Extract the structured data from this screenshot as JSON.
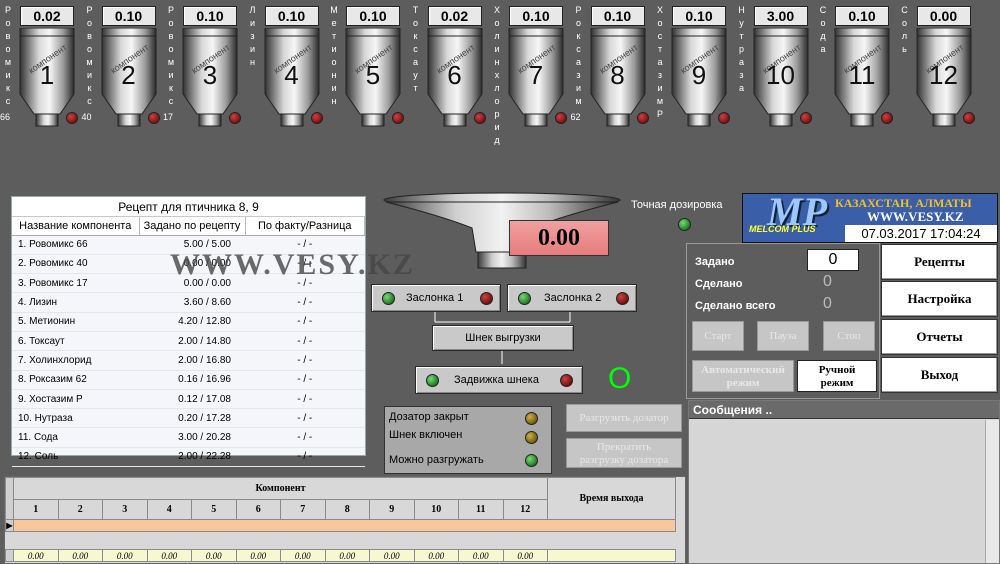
{
  "hoppers": [
    {
      "num": "1",
      "value": "0.02",
      "vname": "Ровомикс",
      "extra": "66"
    },
    {
      "num": "2",
      "value": "0.10",
      "vname": "Ровомикс",
      "extra": "40"
    },
    {
      "num": "3",
      "value": "0.10",
      "vname": "Ровомикс",
      "extra": "17"
    },
    {
      "num": "4",
      "value": "0.10",
      "vname": "Лизин",
      "extra": ""
    },
    {
      "num": "5",
      "value": "0.10",
      "vname": "Метионин",
      "extra": ""
    },
    {
      "num": "6",
      "value": "0.02",
      "vname": "Токсаут",
      "extra": ""
    },
    {
      "num": "7",
      "value": "0.10",
      "vname": "Холинхлорид",
      "extra": ""
    },
    {
      "num": "8",
      "value": "0.10",
      "vname": "Роксазим",
      "extra": "62"
    },
    {
      "num": "9",
      "value": "0.10",
      "vname": "ХостазимР",
      "extra": ""
    },
    {
      "num": "10",
      "value": "3.00",
      "vname": "Нутраза",
      "extra": ""
    },
    {
      "num": "11",
      "value": "0.10",
      "vname": "Сода",
      "extra": ""
    },
    {
      "num": "12",
      "value": "0.00",
      "vname": "Соль",
      "extra": ""
    }
  ],
  "hopper_label": "компонент",
  "recipe": {
    "title": "Рецепт для птичника 8, 9",
    "headers": [
      "Название компонента",
      "Задано по рецепту",
      "По факту/Разница"
    ],
    "rows": [
      [
        "1. Ровомикс 66",
        "5.00 / 5.00",
        "- / -"
      ],
      [
        "2. Ровомикс 40",
        "0.00 / 0.00",
        "- / -"
      ],
      [
        "3. Ровомикс 17",
        "0.00 / 0.00",
        "- / -"
      ],
      [
        "4. Лизин",
        "3.60 / 8.60",
        "- / -"
      ],
      [
        "5. Метионин",
        "4.20 / 12.80",
        "- / -"
      ],
      [
        "6. Токсаут",
        "2.00 / 14.80",
        "- / -"
      ],
      [
        "7. Холинхлорид",
        "2.00 / 16.80",
        "- / -"
      ],
      [
        "8. Роксазим 62",
        "0.16 / 16.96",
        "- / -"
      ],
      [
        "9. Хостазим P",
        "0.12 / 17.08",
        "- / -"
      ],
      [
        "10. Нутраза",
        "0.20 / 17.28",
        "- / -"
      ],
      [
        "11. Сода",
        "3.00 / 20.28",
        "- / -"
      ],
      [
        "12. Соль",
        "2.00 / 22.28",
        "- / -"
      ]
    ]
  },
  "watermark": "WWW.VESY.KZ",
  "dosator": {
    "weight": "0.00",
    "precise_label": "Точная дозировка",
    "valve1": "Заслонка 1",
    "valve2": "Заслонка 2",
    "auger": "Шнек выгрузки",
    "gate": "Задвижка шнека",
    "o_indicator": "O",
    "status": [
      "Дозатор закрыт",
      "Шнек включен",
      "Можно разгружать"
    ],
    "unload_btn": "Разгрузить дозатор",
    "stop_unload_btn": [
      "Прекратить",
      "разгрузку дозатора"
    ]
  },
  "logo": {
    "brand": "MP",
    "sub": "MELCOM PLUS",
    "city": "КАЗАХСТАН, АЛМАТЫ",
    "site": "WWW.VESY.KZ",
    "datetime": "07.03.2017 17:04:24"
  },
  "control": {
    "set_label": "Задано",
    "set_value": "0",
    "done_label": "Сделано",
    "done_value": "0",
    "done_total_label": "Сделано всего",
    "done_total_value": "0",
    "start": "Старт",
    "pause": "Пауза",
    "stop": "Стоп",
    "auto_mode": [
      "Автоматический",
      "режим"
    ],
    "manual_mode": [
      "Ручной",
      "режим"
    ]
  },
  "menu": [
    "Рецепты",
    "Настройка",
    "Отчеты",
    "Выход"
  ],
  "messages": {
    "title": "Сообщения .."
  },
  "grid": {
    "group_header": "Компонент",
    "time_header": "Время выхода",
    "cols": [
      "1",
      "2",
      "3",
      "4",
      "5",
      "6",
      "7",
      "8",
      "9",
      "10",
      "11",
      "12"
    ],
    "values": [
      "0.00",
      "0.00",
      "0.00",
      "0.00",
      "0.00",
      "0.00",
      "0.00",
      "0.00",
      "0.00",
      "0.00",
      "0.00",
      "0.00"
    ]
  }
}
